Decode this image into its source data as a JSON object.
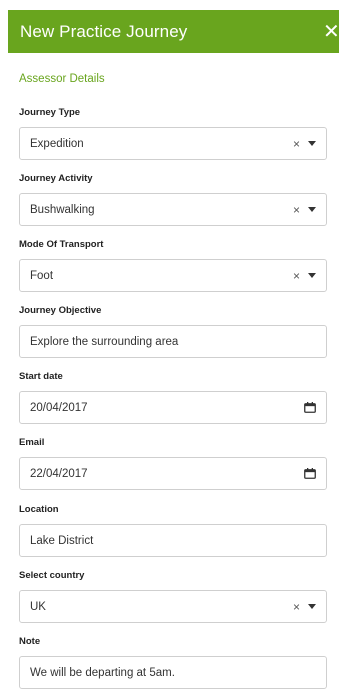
{
  "header": {
    "title": "New Practice Journey",
    "close_symbol": "✕"
  },
  "assessor_link": "Assessor Details",
  "icons": {
    "clear": "×",
    "clear_icon_name": "clear-selection-icon",
    "caret_icon_name": "chevron-down-icon",
    "calendar_icon_name": "calendar-icon"
  },
  "colors": {
    "accent": "#69a51e",
    "border": "#cfcfcf"
  },
  "fields": {
    "journey_type": {
      "label": "Journey Type",
      "value": "Expedition"
    },
    "journey_activity": {
      "label": "Journey Activity",
      "value": "Bushwalking"
    },
    "mode_of_transport": {
      "label": "Mode Of Transport",
      "value": "Foot"
    },
    "journey_objective": {
      "label": "Journey Objective",
      "value": "Explore the surrounding area"
    },
    "start_date": {
      "label": "Start date",
      "value": "20/04/2017"
    },
    "email": {
      "label": "Email",
      "value": "22/04/2017"
    },
    "location": {
      "label": "Location",
      "value": "Lake District"
    },
    "select_country": {
      "label": "Select country",
      "value": "UK"
    },
    "note": {
      "label": "Note",
      "value": "We will be departing at 5am."
    }
  }
}
